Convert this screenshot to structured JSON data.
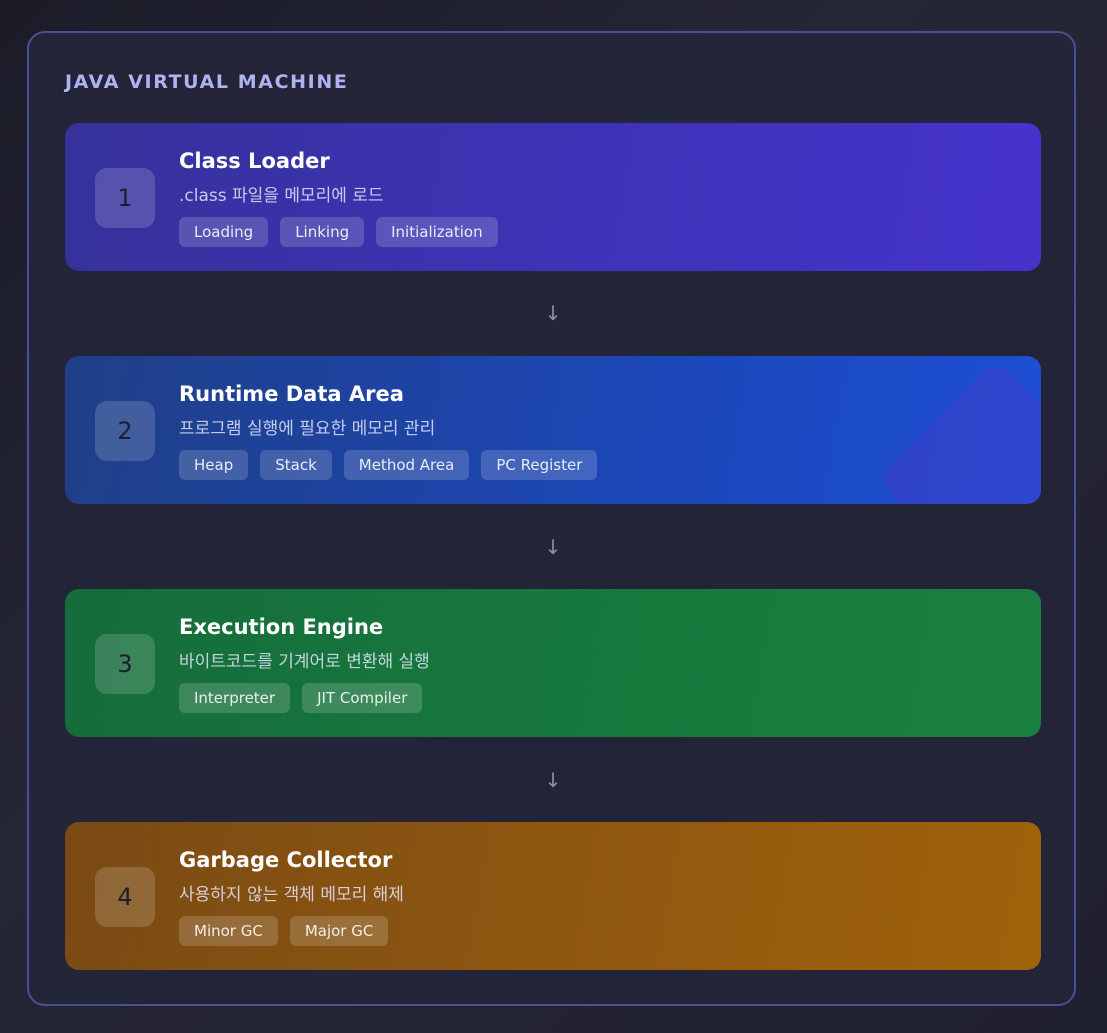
{
  "title": "JAVA VIRTUAL MACHINE",
  "arrow_glyph": "↓",
  "stages": [
    {
      "number": "1",
      "title": "Class Loader",
      "description": ".class 파일을 메모리에 로드",
      "tags": [
        "Loading",
        "Linking",
        "Initialization"
      ]
    },
    {
      "number": "2",
      "title": "Runtime Data Area",
      "description": "프로그램 실행에 필요한 메모리 관리",
      "tags": [
        "Heap",
        "Stack",
        "Method Area",
        "PC Register"
      ]
    },
    {
      "number": "3",
      "title": "Execution Engine",
      "description": "바이트코드를 기계어로 변환해 실행",
      "tags": [
        "Interpreter",
        "JIT Compiler"
      ]
    },
    {
      "number": "4",
      "title": "Garbage Collector",
      "description": "사용하지 않는 객체 메모리 해제",
      "tags": [
        "Minor GC",
        "Major GC"
      ]
    }
  ],
  "colors": {
    "class_loader": "#3d33b8",
    "runtime_data_area": "#1c47b8",
    "execution_engine": "#177a3d",
    "garbage_collector": "#925a10",
    "frame_border": "#4a4f9a",
    "title": "#aeb3f2"
  }
}
